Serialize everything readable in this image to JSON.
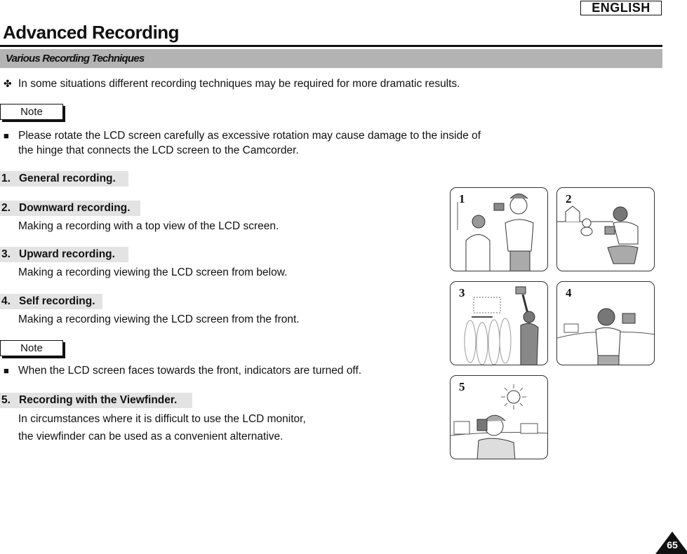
{
  "header": {
    "language_badge": "ENGLISH",
    "page_title": "Advanced Recording",
    "section_title": "Various Recording Techniques"
  },
  "intro": {
    "bullet_icon": "four-leaf-clover-icon",
    "bullet_glyph": "✤",
    "text": "In some situations different recording techniques may be required for more dramatic results."
  },
  "notes": [
    {
      "label": "Note",
      "bullet_glyph": "■",
      "lines": [
        "Please rotate the LCD screen carefully as excessive rotation may cause damage to the inside of",
        "the hinge that connects the LCD screen to the Camcorder."
      ]
    },
    {
      "label": "Note",
      "bullet_glyph": "■",
      "lines": [
        "When the LCD screen faces towards the front, indicators are turned off."
      ]
    }
  ],
  "techniques": [
    {
      "number": "1.",
      "title": "General recording.",
      "description": []
    },
    {
      "number": "2.",
      "title": "Downward recording.",
      "description": [
        "Making a recording with a top view of the LCD screen."
      ]
    },
    {
      "number": "3.",
      "title": "Upward recording.",
      "description": [
        "Making a recording viewing the LCD screen from below."
      ]
    },
    {
      "number": "4.",
      "title": "Self recording.",
      "description": [
        "Making a recording viewing the LCD screen from the front."
      ]
    },
    {
      "number": "5.",
      "title": "Recording with the Viewfinder.",
      "description": [
        "In circumstances where it is difficult to use the LCD monitor,",
        "the viewfinder can be used as a convenient alternative."
      ]
    }
  ],
  "illustrations": [
    {
      "number": "1",
      "subject": "general-recording-illustration"
    },
    {
      "number": "2",
      "subject": "downward-recording-illustration"
    },
    {
      "number": "3",
      "subject": "upward-recording-illustration"
    },
    {
      "number": "4",
      "subject": "self-recording-illustration"
    },
    {
      "number": "5",
      "subject": "viewfinder-recording-illustration"
    }
  ],
  "footer": {
    "page_number": "65"
  }
}
